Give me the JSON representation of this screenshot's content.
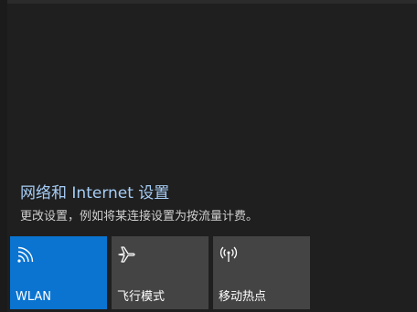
{
  "network_settings": {
    "link_label": "网络和 Internet 设置",
    "description": "更改设置，例如将某连接设置为按流量计费。"
  },
  "quick_actions": [
    {
      "label": "WLAN",
      "icon": "wifi-icon",
      "active": true,
      "color": "#0a74d0"
    },
    {
      "label": "飞行模式",
      "icon": "airplane-icon",
      "active": false,
      "color": "#444444"
    },
    {
      "label": "移动热点",
      "icon": "mobile-hotspot-icon",
      "active": false,
      "color": "#444444"
    }
  ],
  "colors": {
    "background": "#1f1f1f",
    "link": "#a6cdf6",
    "accent": "#0a74d0",
    "tile_inactive": "#444444"
  }
}
